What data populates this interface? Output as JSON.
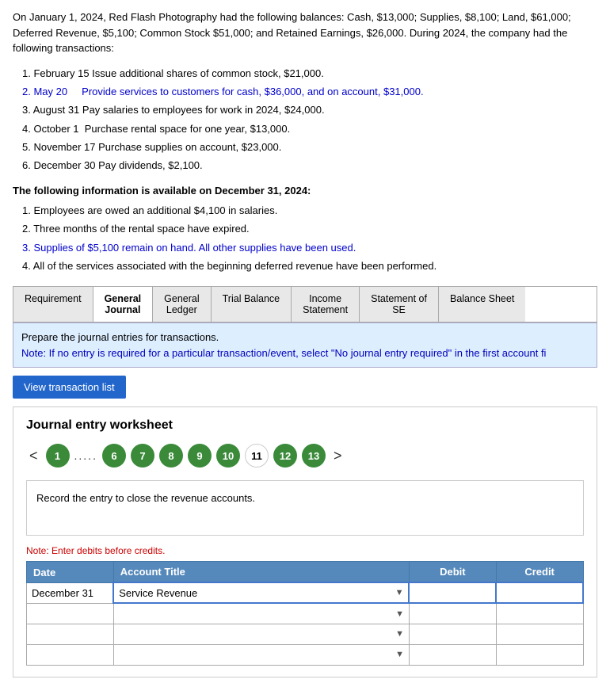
{
  "intro": {
    "text": "On January 1, 2024, Red Flash Photography had the following balances: Cash, $13,000; Supplies, $8,100; Land, $61,000; Deferred Revenue, $5,100; Common Stock $51,000; and Retained Earnings, $26,000. During 2024, the company had the following transactions:"
  },
  "transactions": [
    {
      "num": "1.",
      "date": "February 15",
      "desc": "Issue additional shares of common stock, $21,000."
    },
    {
      "num": "2.",
      "date": "May 20",
      "desc": "Provide services to customers for cash, $36,000, and on account, $31,000."
    },
    {
      "num": "3.",
      "date": "August 31",
      "desc": "Pay salaries to employees for work in 2024, $24,000."
    },
    {
      "num": "4.",
      "date": "October 1",
      "desc": "Purchase rental space for one year, $13,000."
    },
    {
      "num": "5.",
      "date": "November 17",
      "desc": "Purchase supplies on account, $23,000."
    },
    {
      "num": "6.",
      "date": "December 30",
      "desc": "Pay dividends, $2,100."
    }
  ],
  "additional_info_title": "The following information is available on December 31, 2024:",
  "additional_info": [
    "1. Employees are owed an additional $4,100 in salaries.",
    "2. Three months of the rental space have expired.",
    "3. Supplies of $5,100 remain on hand. All other supplies have been used.",
    "4. All of the services associated with the beginning deferred revenue have been performed."
  ],
  "tabs": [
    {
      "label": "Requirement",
      "active": false
    },
    {
      "label": "General Journal",
      "active": true
    },
    {
      "label": "General Ledger",
      "active": false
    },
    {
      "label": "Trial Balance",
      "active": false
    },
    {
      "label": "Income Statement",
      "active": false
    },
    {
      "label": "Statement of SE",
      "active": false
    },
    {
      "label": "Balance Sheet",
      "active": false
    }
  ],
  "instruction": {
    "main": "Prepare the journal entries for transactions.",
    "note": "Note: If no entry is required for a particular transaction/event, select \"No journal entry required\" in the first account fi"
  },
  "view_btn_label": "View transaction list",
  "worksheet": {
    "title": "Journal entry worksheet",
    "nav": {
      "prev_label": "<",
      "next_label": ">",
      "items": [
        {
          "num": "1",
          "style": "green"
        },
        {
          "num": "......",
          "style": "dots"
        },
        {
          "num": "6",
          "style": "green"
        },
        {
          "num": "7",
          "style": "green"
        },
        {
          "num": "8",
          "style": "green"
        },
        {
          "num": "9",
          "style": "green"
        },
        {
          "num": "10",
          "style": "green"
        },
        {
          "num": "11",
          "style": "white"
        },
        {
          "num": "12",
          "style": "green"
        },
        {
          "num": "13",
          "style": "green"
        }
      ]
    },
    "record_text": "Record the entry to close the revenue accounts.",
    "note": "Note: Enter debits before credits.",
    "table": {
      "headers": [
        "Date",
        "Account Title",
        "Debit",
        "Credit"
      ],
      "rows": [
        {
          "date": "December 31",
          "account": "Service Revenue",
          "debit": "",
          "credit": ""
        },
        {
          "date": "",
          "account": "",
          "debit": "",
          "credit": ""
        },
        {
          "date": "",
          "account": "",
          "debit": "",
          "credit": ""
        },
        {
          "date": "",
          "account": "",
          "debit": "",
          "credit": ""
        }
      ]
    }
  }
}
